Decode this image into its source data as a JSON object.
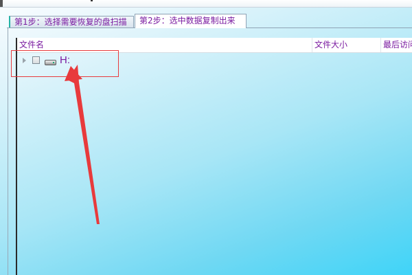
{
  "tabs": [
    {
      "label": "第1步：选择需要恢复的盘扫描",
      "active": false
    },
    {
      "label": "第2步：选中数据复制出来",
      "active": true
    }
  ],
  "table": {
    "columns": [
      "文件名",
      "文件大小",
      "最后访问"
    ]
  },
  "tree": {
    "items": [
      {
        "label": "H:",
        "icon": "drive-icon",
        "checked": false,
        "expanded": false
      }
    ]
  },
  "annotation": {
    "color": "#e83a3c"
  }
}
